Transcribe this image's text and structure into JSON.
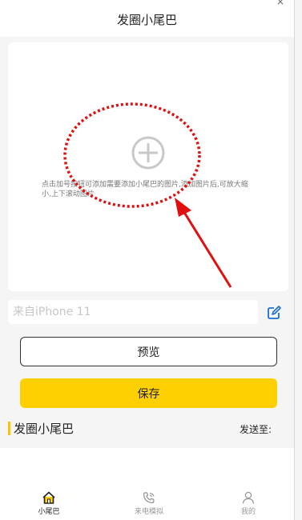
{
  "header": {
    "title": "发圈小尾巴",
    "close_hint": "×"
  },
  "canvas": {
    "hint": "点击加号按钮可添加需要添加小尾巴的图片,添加图片后,可放大缩小,上下滚动图片"
  },
  "device": {
    "placeholder": "来自iPhone 11",
    "value": ""
  },
  "buttons": {
    "preview": "预览",
    "save": "保存"
  },
  "section": {
    "title": "发圈小尾巴",
    "send_to": "发送至:"
  },
  "tabbar": {
    "items": [
      {
        "label": "小尾巴",
        "icon": "home-icon",
        "active": true
      },
      {
        "label": "来电模拟",
        "icon": "phone-icon",
        "active": false
      },
      {
        "label": "我的",
        "icon": "user-icon",
        "active": false
      }
    ]
  },
  "colors": {
    "accent": "#ffd000",
    "annotation": "#e01010"
  }
}
